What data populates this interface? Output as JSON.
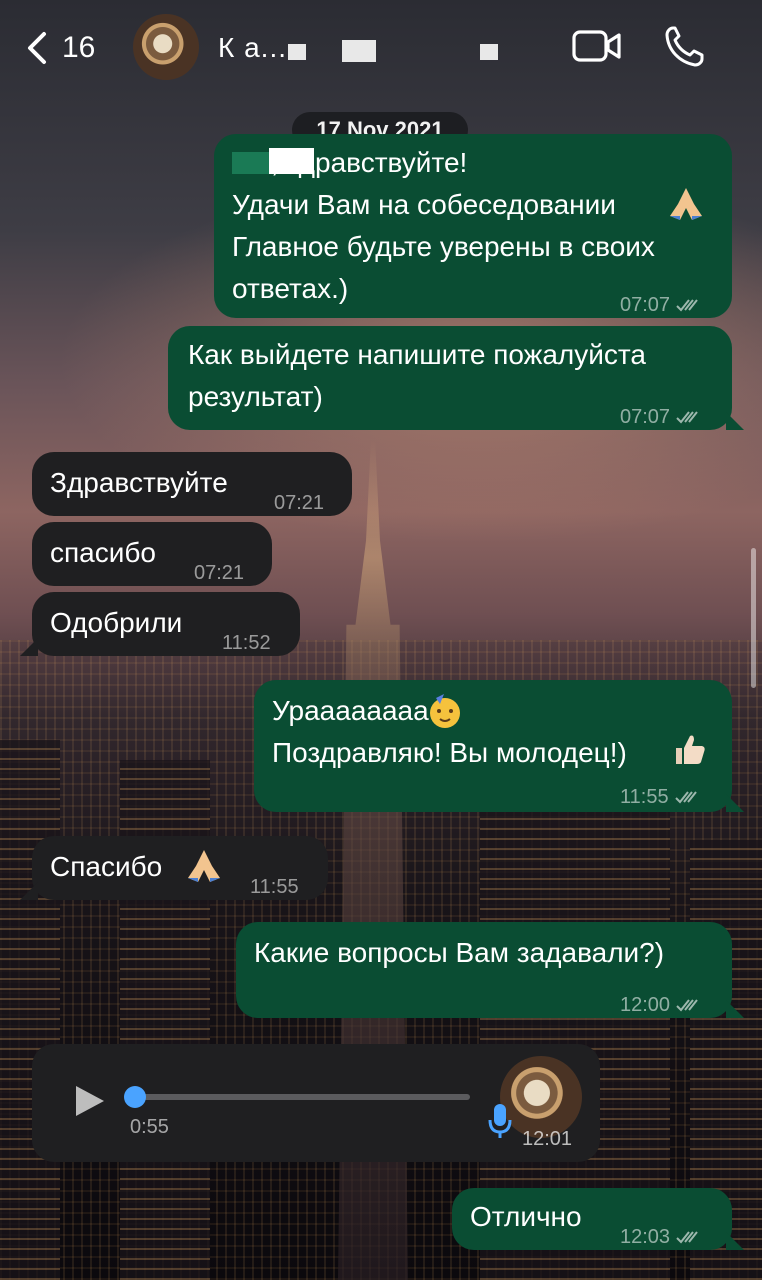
{
  "header": {
    "back_count": "16",
    "contact_name": "К                    а...",
    "video_icon": "video-camera-icon",
    "call_icon": "phone-icon"
  },
  "date_chip": "17 Nov 2021",
  "messages": [
    {
      "dir": "out",
      "text": "     , здравствуйте!\nУдачи Вам на собеседовании\nГлавное будьте уверены в своих\nответах.)",
      "time": "07:07",
      "read": true
    },
    {
      "dir": "out",
      "text": "Как выйдете напишите пожалуйста\nрезультат)",
      "time": "07:07",
      "read": true
    },
    {
      "dir": "in",
      "text": "Здравствуйте",
      "time": "07:21"
    },
    {
      "dir": "in",
      "text": "спасибо",
      "time": "07:21"
    },
    {
      "dir": "in",
      "text": "Одобрили",
      "time": "11:52"
    },
    {
      "dir": "out",
      "text": "Ураааааааа\nПоздравляю! Вы молодец!)",
      "time": "11:55",
      "read": true
    },
    {
      "dir": "in",
      "text": "Спасибо",
      "time": "11:55"
    },
    {
      "dir": "out",
      "text": "Какие вопросы Вам задавали?)",
      "time": "12:00",
      "read": true
    },
    {
      "dir": "out",
      "text": "Отлично",
      "time": "12:03",
      "read": true
    }
  ],
  "voice_message": {
    "duration": "0:55",
    "time": "12:01",
    "progress": 0.0
  },
  "colors": {
    "outgoing_bubble": "#0a4d33",
    "incoming_bubble": "#1f1f21",
    "accent_blue": "#4aa3ff"
  }
}
